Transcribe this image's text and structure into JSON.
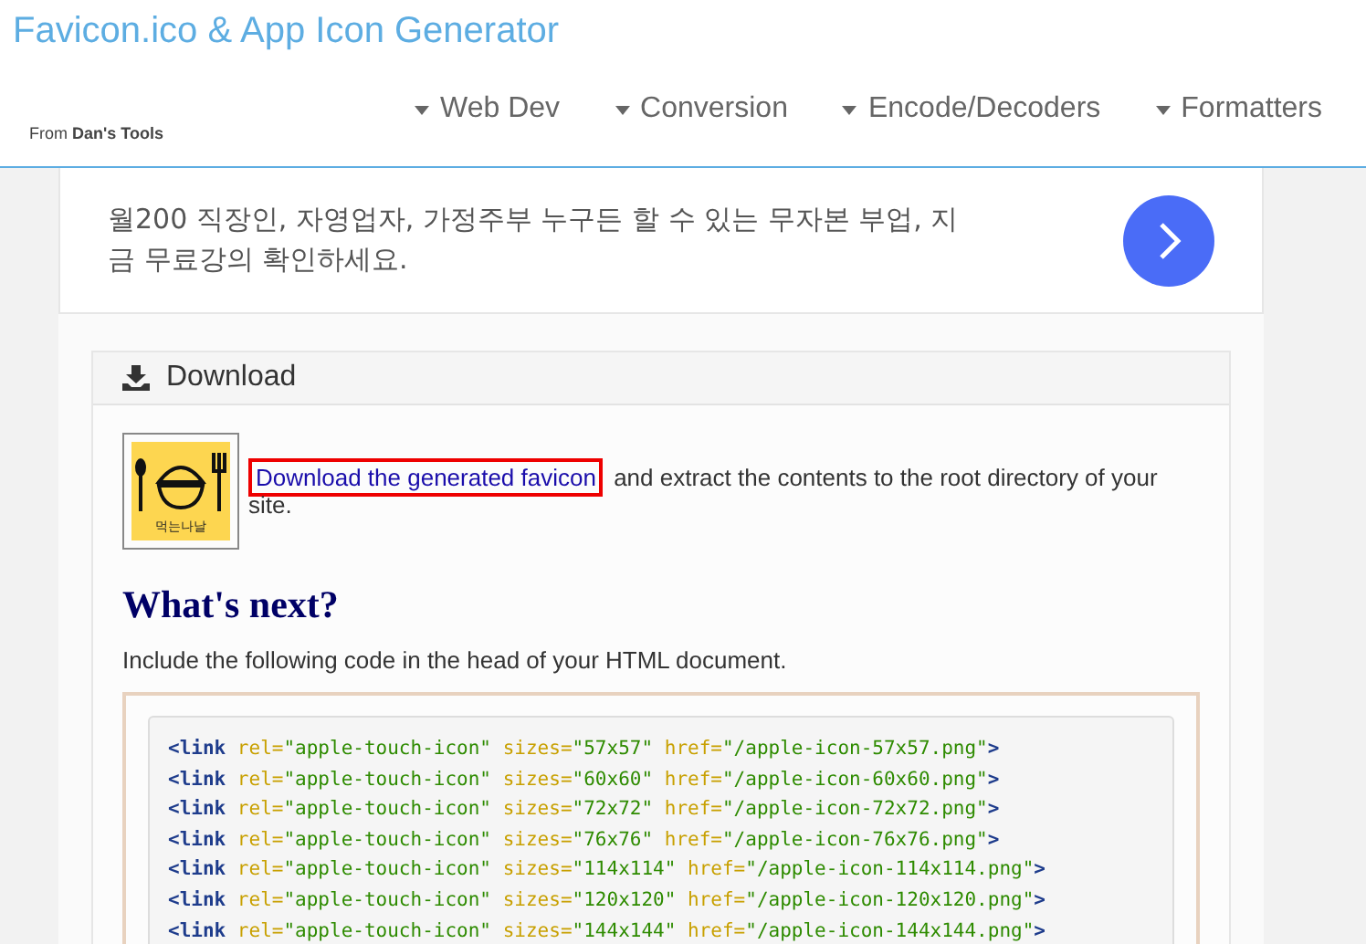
{
  "header": {
    "title": "Favicon.ico & App Icon Generator",
    "from": "From",
    "brand": "Dan's Tools",
    "nav": [
      {
        "label": "Web Dev"
      },
      {
        "label": "Conversion"
      },
      {
        "label": "Encode/Decoders"
      },
      {
        "label": "Formatters"
      }
    ]
  },
  "ad": {
    "text": "월200 직장인, 자영업자, 가정주부 누구든 할 수 있는 무자본 부업, 지금 무료강의 확인하세요."
  },
  "download": {
    "title": "Download",
    "link": "Download the generated favicon",
    "text": " and extract the contents to the root directory of your site.",
    "icon_caption": "먹는나날",
    "next_title": "What's next?",
    "next_text": "Include the following code in the head of your HTML document.",
    "code": [
      [
        {
          "kind": "tag",
          "text": "<link"
        },
        {
          "kind": "attr",
          "text": " rel="
        },
        {
          "kind": "val",
          "text": "\"apple-touch-icon\""
        },
        {
          "kind": "attr",
          "text": " sizes="
        },
        {
          "kind": "val",
          "text": "\"57x57\""
        },
        {
          "kind": "attr",
          "text": " href="
        },
        {
          "kind": "val",
          "text": "\"/apple-icon-57x57.png\""
        },
        {
          "kind": "tag",
          "text": ">"
        }
      ],
      [
        {
          "kind": "tag",
          "text": "<link"
        },
        {
          "kind": "attr",
          "text": " rel="
        },
        {
          "kind": "val",
          "text": "\"apple-touch-icon\""
        },
        {
          "kind": "attr",
          "text": " sizes="
        },
        {
          "kind": "val",
          "text": "\"60x60\""
        },
        {
          "kind": "attr",
          "text": " href="
        },
        {
          "kind": "val",
          "text": "\"/apple-icon-60x60.png\""
        },
        {
          "kind": "tag",
          "text": ">"
        }
      ],
      [
        {
          "kind": "tag",
          "text": "<link"
        },
        {
          "kind": "attr",
          "text": " rel="
        },
        {
          "kind": "val",
          "text": "\"apple-touch-icon\""
        },
        {
          "kind": "attr",
          "text": " sizes="
        },
        {
          "kind": "val",
          "text": "\"72x72\""
        },
        {
          "kind": "attr",
          "text": " href="
        },
        {
          "kind": "val",
          "text": "\"/apple-icon-72x72.png\""
        },
        {
          "kind": "tag",
          "text": ">"
        }
      ],
      [
        {
          "kind": "tag",
          "text": "<link"
        },
        {
          "kind": "attr",
          "text": " rel="
        },
        {
          "kind": "val",
          "text": "\"apple-touch-icon\""
        },
        {
          "kind": "attr",
          "text": " sizes="
        },
        {
          "kind": "val",
          "text": "\"76x76\""
        },
        {
          "kind": "attr",
          "text": " href="
        },
        {
          "kind": "val",
          "text": "\"/apple-icon-76x76.png\""
        },
        {
          "kind": "tag",
          "text": ">"
        }
      ],
      [
        {
          "kind": "tag",
          "text": "<link"
        },
        {
          "kind": "attr",
          "text": " rel="
        },
        {
          "kind": "val",
          "text": "\"apple-touch-icon\""
        },
        {
          "kind": "attr",
          "text": " sizes="
        },
        {
          "kind": "val",
          "text": "\"114x114\""
        },
        {
          "kind": "attr",
          "text": " href="
        },
        {
          "kind": "val",
          "text": "\"/apple-icon-114x114.png\""
        },
        {
          "kind": "tag",
          "text": ">"
        }
      ],
      [
        {
          "kind": "tag",
          "text": "<link"
        },
        {
          "kind": "attr",
          "text": " rel="
        },
        {
          "kind": "val",
          "text": "\"apple-touch-icon\""
        },
        {
          "kind": "attr",
          "text": " sizes="
        },
        {
          "kind": "val",
          "text": "\"120x120\""
        },
        {
          "kind": "attr",
          "text": " href="
        },
        {
          "kind": "val",
          "text": "\"/apple-icon-120x120.png\""
        },
        {
          "kind": "tag",
          "text": ">"
        }
      ],
      [
        {
          "kind": "tag",
          "text": "<link"
        },
        {
          "kind": "attr",
          "text": " rel="
        },
        {
          "kind": "val",
          "text": "\"apple-touch-icon\""
        },
        {
          "kind": "attr",
          "text": " sizes="
        },
        {
          "kind": "val",
          "text": "\"144x144\""
        },
        {
          "kind": "attr",
          "text": " href="
        },
        {
          "kind": "val",
          "text": "\"/apple-icon-144x144.png\""
        },
        {
          "kind": "tag",
          "text": ">"
        }
      ]
    ]
  }
}
